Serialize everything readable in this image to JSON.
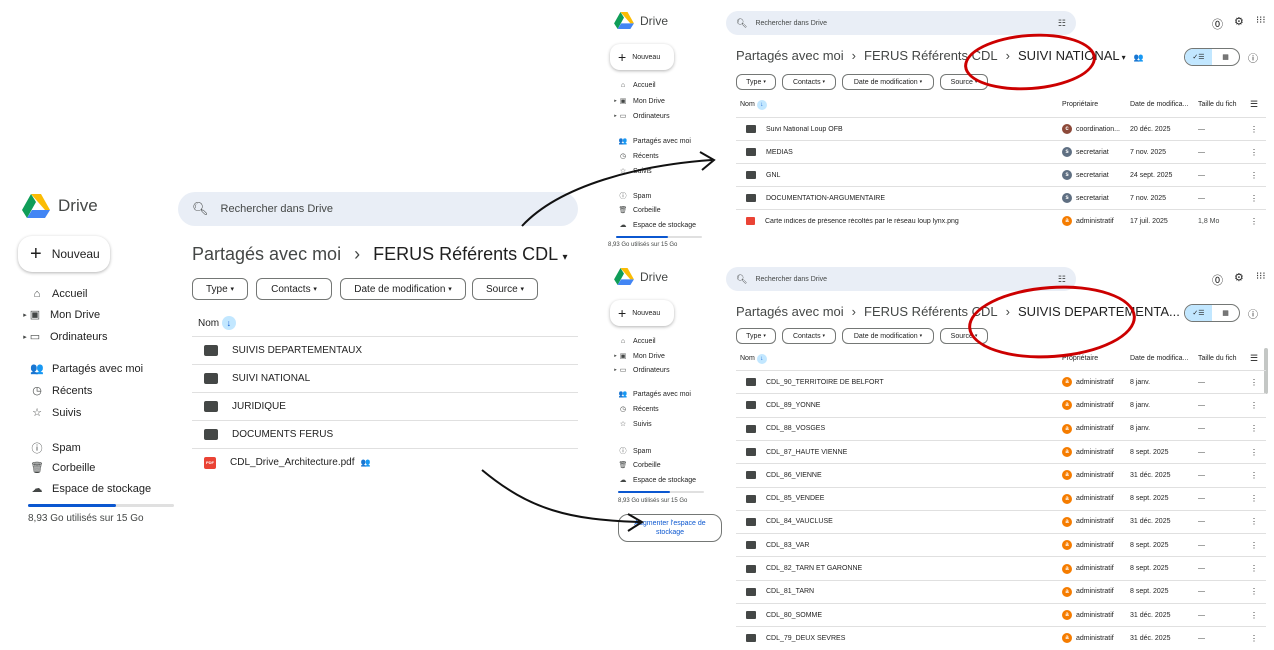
{
  "app": {
    "name": "Drive",
    "search_placeholder": "Rechercher dans Drive",
    "new_label": "Nouveau"
  },
  "nav": {
    "home": "Accueil",
    "mydrive": "Mon Drive",
    "computers": "Ordinateurs",
    "shared": "Partagés avec moi",
    "recent": "Récents",
    "starred": "Suivis",
    "spam": "Spam",
    "trash": "Corbeille",
    "storage": "Espace de stockage",
    "quota_text": "8,93 Go utilisés sur 15 Go",
    "quota_fraction": 0.6,
    "buy_storage": "Augmenter l'espace de stockage"
  },
  "filters": {
    "type": "Type",
    "contacts": "Contacts",
    "modified": "Date de modification",
    "source": "Source"
  },
  "columns": {
    "name": "Nom",
    "owner": "Propriétaire",
    "date": "Date de modifica...",
    "size": "Taille du fich"
  },
  "left": {
    "crumb1": "Partagés avec moi",
    "sep": "›",
    "crumb2": "FERUS Référents CDL",
    "rows": [
      {
        "name": "SUIVIS DEPARTEMENTAUX"
      },
      {
        "name": "SUIVI NATIONAL"
      },
      {
        "name": "JURIDIQUE"
      },
      {
        "name": "DOCUMENTS FERUS"
      },
      {
        "name": "CDL_Drive_Architecture.pdf"
      }
    ]
  },
  "top": {
    "crumb1": "Partagés avec moi",
    "crumb2": "FERUS Référents CDL",
    "crumb3": "SUIVI NATIONAL",
    "rows": [
      {
        "name": "Suivi National Loup OFB",
        "owner": "coordination...",
        "av": "c",
        "avc": "#8d4a3a",
        "date": "20 déc. 2025",
        "size": "—"
      },
      {
        "name": "MEDIAS",
        "owner": "secretariat",
        "av": "s",
        "avc": "#5f6f82",
        "date": "7 nov. 2025",
        "size": "—"
      },
      {
        "name": "GNL",
        "owner": "secretariat",
        "av": "s",
        "avc": "#5f6f82",
        "date": "24 sept. 2025",
        "size": "—"
      },
      {
        "name": "DOCUMENTATION-ARGUMENTAIRE",
        "owner": "secretariat",
        "av": "s",
        "avc": "#5f6f82",
        "date": "7 nov. 2025",
        "size": "—"
      },
      {
        "name": "Carte indices de présence récoltés par le réseau loup lynx.png",
        "owner": "administratif",
        "av": "a",
        "avc": "#f57c00",
        "date": "17 juil. 2025",
        "size": "1,8 Mo"
      }
    ]
  },
  "bottom": {
    "crumb1": "Partagés avec moi",
    "crumb2": "FERUS Référents CDL",
    "crumb3": "SUIVIS DEPARTEMENTA...",
    "rows": [
      {
        "name": "CDL_90_TERRITOIRE DE BELFORT",
        "owner": "administratif",
        "date": "8 janv.",
        "size": "—"
      },
      {
        "name": "CDL_89_YONNE",
        "owner": "administratif",
        "date": "8 janv.",
        "size": "—"
      },
      {
        "name": "CDL_88_VOSGES",
        "owner": "administratif",
        "date": "8 janv.",
        "size": "—"
      },
      {
        "name": "CDL_87_HAUTE VIENNE",
        "owner": "administratif",
        "date": "8 sept. 2025",
        "size": "—"
      },
      {
        "name": "CDL_86_VIENNE",
        "owner": "administratif",
        "date": "31 déc. 2025",
        "size": "—"
      },
      {
        "name": "CDL_85_VENDEE",
        "owner": "administratif",
        "date": "8 sept. 2025",
        "size": "—"
      },
      {
        "name": "CDL_84_VAUCLUSE",
        "owner": "administratif",
        "date": "31 déc. 2025",
        "size": "—"
      },
      {
        "name": "CDL_83_VAR",
        "owner": "administratif",
        "date": "8 sept. 2025",
        "size": "—"
      },
      {
        "name": "CDL_82_TARN ET GARONNE",
        "owner": "administratif",
        "date": "8 sept. 2025",
        "size": "—"
      },
      {
        "name": "CDL_81_TARN",
        "owner": "administratif",
        "date": "8 sept. 2025",
        "size": "—"
      },
      {
        "name": "CDL_80_SOMME",
        "owner": "administratif",
        "date": "31 déc. 2025",
        "size": "—"
      },
      {
        "name": "CDL_79_DEUX SEVRES",
        "owner": "administratif",
        "date": "31 déc. 2025",
        "size": "—"
      }
    ]
  },
  "colors": {
    "accent": "#0b57d0",
    "circle": "#cc0000",
    "avatar_orange": "#f57c00"
  }
}
